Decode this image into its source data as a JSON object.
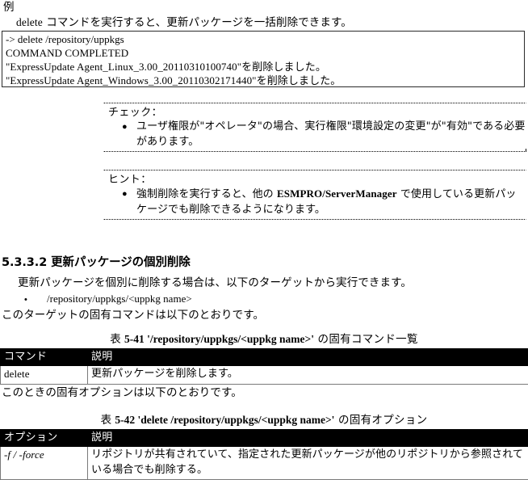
{
  "example": {
    "heading": "例",
    "intro_command": "delete",
    "intro_text": " コマンドを実行すると、更新パッケージを一括削除できます。",
    "console_lines": [
      "-> delete /repository/uppkgs",
      "COMMAND COMPLETED",
      "\"ExpressUpdate Agent_Linux_3.00_20110310100740\"を削除しました。",
      "\"ExpressUpdate Agent_Windows_3.00_20110302171440\"を削除しました。"
    ]
  },
  "check_box": {
    "label": "チェック：",
    "item": "ユーザ権限が\"オペレータ\"の場合、実行権限\"環境設定の変更\"が\"有効\"である必要があります。"
  },
  "hint_box": {
    "label": "ヒント：",
    "item_prefix": "強制削除を実行すると、他の ",
    "item_product": "ESMPRO/ServerManager",
    "item_suffix": " で使用している更新パッケージでも削除できるようになります。"
  },
  "section": {
    "number": "5.3.3.2",
    "title": "更新パッケージの個別削除",
    "heading_full": "5.3.3.2 更新パッケージの個別削除",
    "intro": "更新パッケージを個別に削除する場合は、以下のターゲットから実行できます。",
    "target_bullet": "•",
    "target_path": "/repository/uppkgs/<uppkg name>",
    "after_target": "このターゲットの固有コマンドは以下のとおりです。",
    "after_table_1": "このときの固有オプションは以下のとおりです。"
  },
  "table_5_41": {
    "caption_label": "表",
    "caption_number": "5-41 '/repository/uppkgs/<uppkg name>'",
    "caption_tail": " の固有コマンド一覧",
    "headers": [
      "コマンド",
      "説明"
    ],
    "rows": [
      [
        "delete",
        "更新パッケージを削除します。"
      ]
    ]
  },
  "table_5_42": {
    "caption_label": "表",
    "caption_number": "5-42 'delete /repository/uppkgs/<uppkg name>'",
    "caption_tail": " の固有オプション",
    "headers": [
      "オプション",
      "説明"
    ],
    "rows": [
      [
        "-f / -force",
        "リポジトリが共有されていて、指定された更新パッケージが他のリポジトリから参照されている場合でも削除する。"
      ]
    ]
  },
  "colors": {
    "text": "#000000",
    "page_background": "#ffffff",
    "table_header_background": "#000000",
    "table_header_text": "#ffffff",
    "table_border": "#7a7a7a",
    "code_box_border": "#2a2a2a"
  }
}
